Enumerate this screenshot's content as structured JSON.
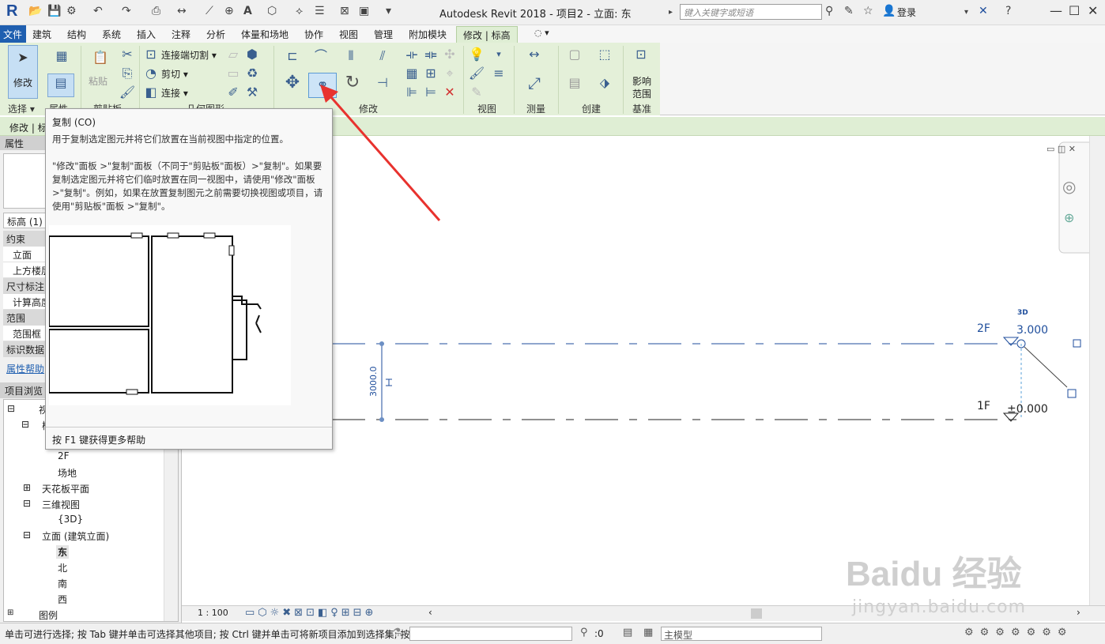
{
  "title_bar": {
    "app_logo": "R",
    "title": "Autodesk Revit 2018 -    项目2 - 立面: 东",
    "search_placeholder": "键入关键字或短语",
    "login": "登录",
    "text_tool": "A"
  },
  "menu": {
    "file": "文件",
    "tabs": [
      "建筑",
      "结构",
      "系统",
      "插入",
      "注释",
      "分析",
      "体量和场地",
      "协作",
      "视图",
      "管理",
      "附加模块",
      "修改 | 标高"
    ]
  },
  "ribbon": {
    "modify_label": "修改",
    "select_label": "选择 ▾",
    "properties_label": "属性",
    "clipboard_label": "剪贴板",
    "paste_label": "粘贴",
    "join_cut": "连接端切割 ▾",
    "cut": "剪切 ▾",
    "join": "连接 ▾",
    "geometry_label": "几何图形",
    "modify_panel": "修改",
    "view_panel": "视图",
    "measure_panel": "测量",
    "create_panel": "创建",
    "datum_panel": "基准",
    "influence_l1": "影响",
    "influence_l2": "范围"
  },
  "context_bar": "修改 | 标",
  "tooltip": {
    "title": "复制 (CO)",
    "desc": "用于复制选定图元并将它们放置在当前视图中指定的位置。",
    "detail": "\"修改\"面板 >\"复制\"面板（不同于\"剪贴板\"面板）>\"复制\"。如果要复制选定图元并将它们临时放置在同一视图中，请使用\"修改\"面板 >\"复制\"。例如，如果在放置复制图元之前需要切换视图或项目，请使用\"剪贴板\"面板 >\"复制\"。",
    "footer": "按 F1 键获得更多帮助"
  },
  "properties": {
    "header": "属性",
    "type_selector": "标高 (1)",
    "sections": [
      {
        "title": "约束",
        "rows": [
          "立面",
          "上方楼层"
        ]
      },
      {
        "title": "尺寸标注",
        "rows": [
          "计算高度"
        ]
      },
      {
        "title": "范围",
        "rows": [
          "范围框"
        ]
      },
      {
        "title": "标识数据",
        "rows": []
      }
    ],
    "help_link": "属性帮助"
  },
  "project_browser": {
    "header": "项目浏览",
    "items": [
      {
        "label": "视",
        "level": 0,
        "toggle": "⊟"
      },
      {
        "label": "楼",
        "level": 1,
        "toggle": "⊟"
      },
      {
        "label": "2F",
        "level": 2
      },
      {
        "label": "场地",
        "level": 2
      },
      {
        "label": "天花板平面",
        "level": 1,
        "toggle": "⊞"
      },
      {
        "label": "三维视图",
        "level": 1,
        "toggle": "⊟"
      },
      {
        "label": "{3D}",
        "level": 2
      },
      {
        "label": "立面 (建筑立面)",
        "level": 1,
        "toggle": "⊟"
      },
      {
        "label": "东",
        "level": 2,
        "selected": true
      },
      {
        "label": "北",
        "level": 2
      },
      {
        "label": "南",
        "level": 2
      },
      {
        "label": "西",
        "level": 2
      },
      {
        "label": "图例",
        "level": 0,
        "toggle": "⊞"
      }
    ]
  },
  "canvas": {
    "level_2": {
      "name": "2F",
      "elevation": "3.000"
    },
    "level_1": {
      "name": "1F",
      "elevation": "±0.000"
    },
    "dimension": "3000.0",
    "label_3d": "3D"
  },
  "view_bar": {
    "scale": "1 : 100"
  },
  "status": {
    "text": "单击可进行选择; 按 Tab 键并单击可选择其他项目; 按 Ctrl 键并单击可将新项目添加到选择集; 按",
    "filter_count": ":0",
    "model": "主模型"
  },
  "watermark": {
    "brand": "Baidu 经验",
    "url": "jingyan.baidu.com"
  }
}
